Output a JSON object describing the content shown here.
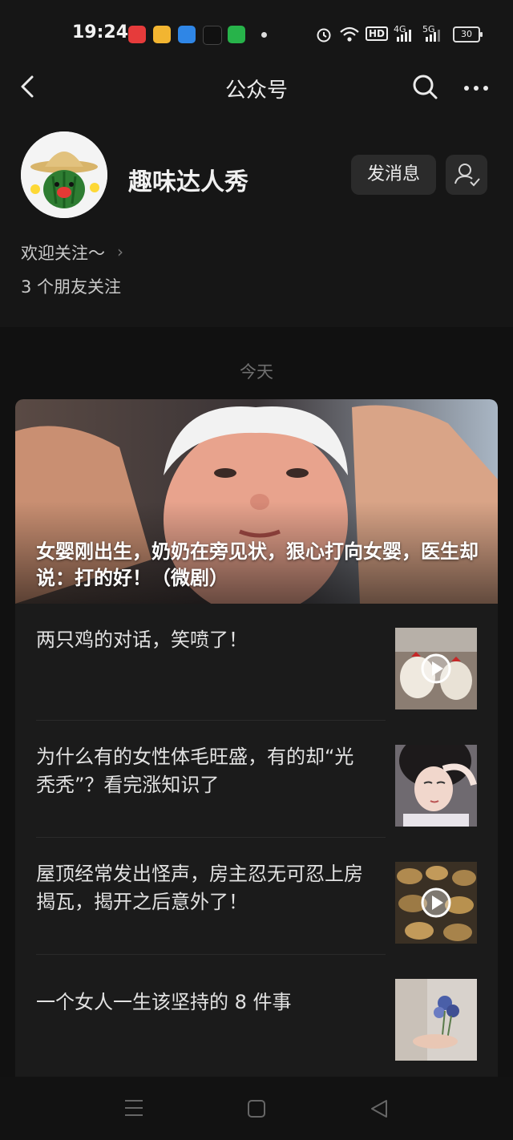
{
  "status_bar": {
    "time": "19:24",
    "app_icons": [
      "toutiao-icon",
      "weibo-icon",
      "browser-icon",
      "tiktok-icon",
      "wechat-plugin-icon"
    ],
    "hd_label": "HD",
    "signal1_label": "4G",
    "signal2_label": "5G",
    "battery": "30"
  },
  "nav": {
    "title": "公众号"
  },
  "profile": {
    "name": "趣味达人秀",
    "message_button": "发消息",
    "welcome": "欢迎关注～",
    "friends": "3 个朋友关注"
  },
  "feed": {
    "date": "今天",
    "hero_title": "女婴刚出生，奶奶在旁见状，狠心打向女婴，医生却说：打的好！（微剧）",
    "articles": [
      {
        "title": "两只鸡的对话，笑喷了！",
        "has_video": true
      },
      {
        "title": "为什么有的女性体毛旺盛，有的却“光秃秃”？看完涨知识了",
        "has_video": false
      },
      {
        "title": "屋顶经常发出怪声，房主忍无可忍上房揭瓦，揭开之后意外了！",
        "has_video": true
      },
      {
        "title": "一个女人一生该坚持的 8 件事",
        "has_video": false
      }
    ]
  },
  "colors": {
    "background": "#111111",
    "panel": "#161616",
    "card": "#1b1b1b",
    "button": "#2b2b2b"
  }
}
